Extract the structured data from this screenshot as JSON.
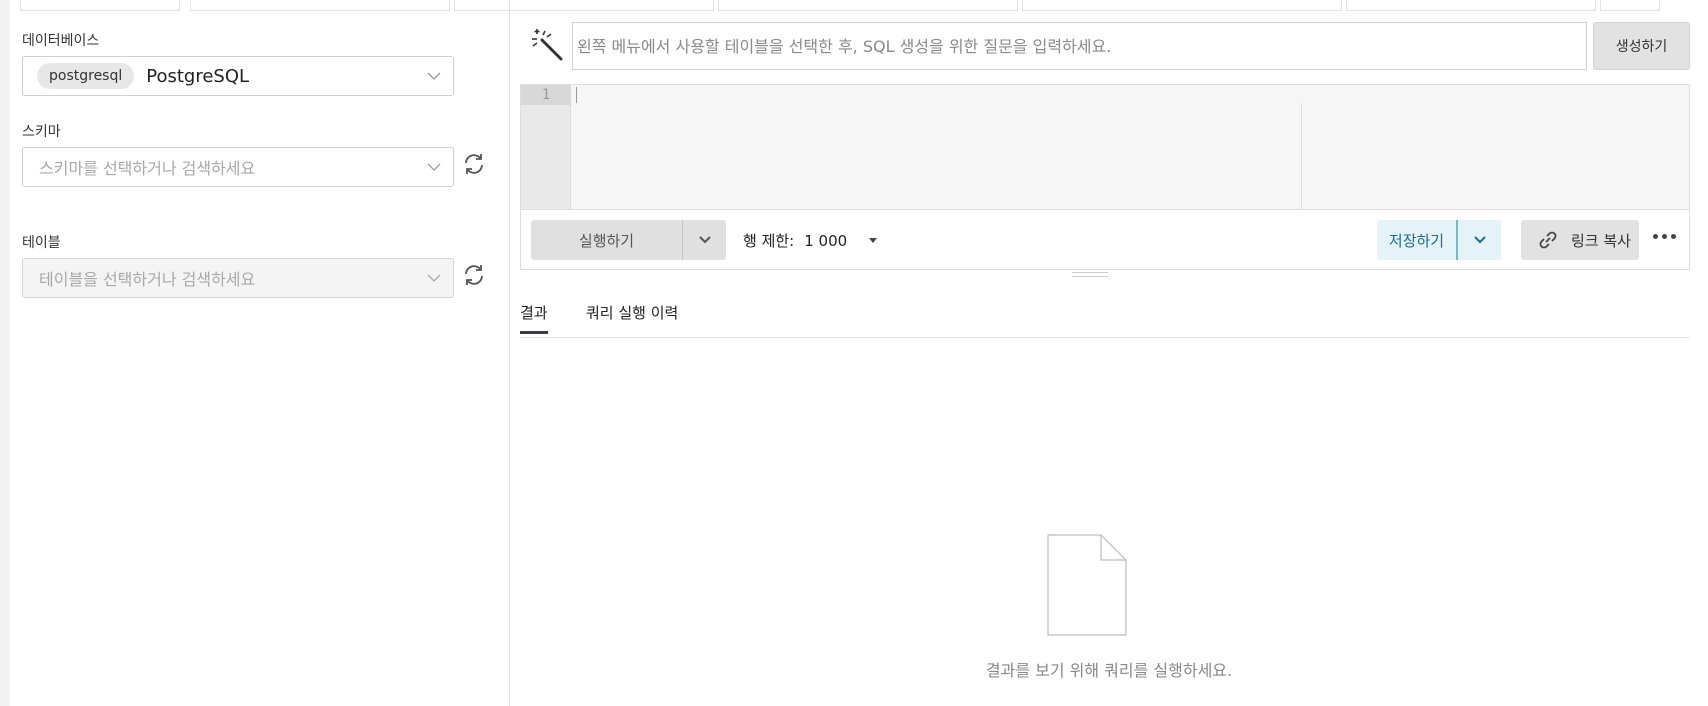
{
  "left_panel": {
    "database": {
      "label": "데이터베이스",
      "chip": "postgresql",
      "value": "PostgreSQL"
    },
    "schema": {
      "label": "스키마",
      "placeholder": "스키마를 선택하거나 검색하세요"
    },
    "table": {
      "label": "테이블",
      "placeholder": "테이블을 선택하거나 검색하세요"
    }
  },
  "prompt": {
    "placeholder": "왼쪽 메뉴에서 사용할 테이블을 선택한 후, SQL 생성을 위한 질문을 입력하세요.",
    "generate_label": "생성하기"
  },
  "editor": {
    "line_number": "1"
  },
  "toolbar": {
    "run_label": "실행하기",
    "limit_label": "행 제한:",
    "limit_value": "1 000",
    "save_label": "저장하기",
    "copy_link_label": "링크 복사"
  },
  "tabs": {
    "results": "결과",
    "history": "쿼리 실행 이력"
  },
  "empty_state": {
    "message": "결과를 보기 위해 쿼리를 실행하세요."
  },
  "colors": {
    "save_bg": "#e3f3f8",
    "save_text": "#1e6d8a",
    "active_tab_indicator": "#3a3a4a"
  }
}
